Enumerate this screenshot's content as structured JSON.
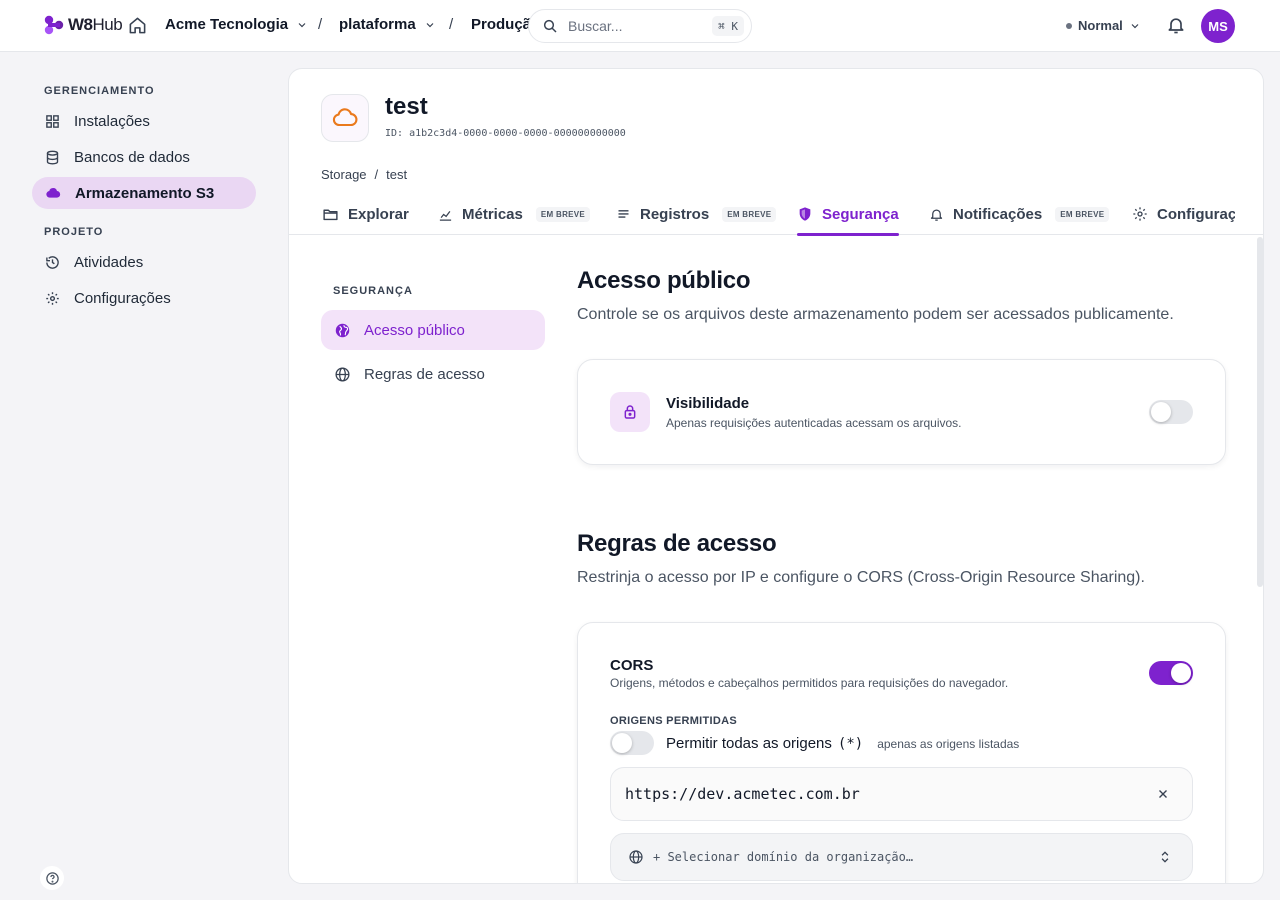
{
  "app": {
    "logo_w8": "W8",
    "logo_hub": "Hub"
  },
  "topbar": {
    "org": "Acme Tecnologia",
    "project": "plataforma",
    "env_crumb": "Produção",
    "separator": "/",
    "search_placeholder": "Buscar...",
    "search_shortcut": "⌘ K",
    "environment": "Normal",
    "avatar_initials": "MS"
  },
  "sidebar": {
    "section_management": "GERENCIAMENTO",
    "items_management": [
      {
        "label": "Instalações",
        "icon": "grid-icon"
      },
      {
        "label": "Bancos de dados",
        "icon": "database-icon"
      },
      {
        "label": "Armazenamento S3",
        "icon": "cloud-icon",
        "active": true
      }
    ],
    "section_project": "PROJETO",
    "items_project": [
      {
        "label": "Atividades",
        "icon": "history-icon"
      },
      {
        "label": "Configurações",
        "icon": "gear-icon"
      }
    ]
  },
  "resource": {
    "name": "test",
    "id": "ID: a1b2c3d4-0000-0000-0000-000000000000",
    "breadcrumb": [
      "Storage",
      "/",
      "test"
    ]
  },
  "tabs": [
    {
      "label": "Explorar",
      "icon": "folder-icon"
    },
    {
      "label": "Métricas",
      "icon": "chart-icon",
      "badge": "EM BREVE"
    },
    {
      "label": "Registros",
      "icon": "list-icon",
      "badge": "EM BREVE"
    },
    {
      "label": "Segurança",
      "icon": "shield-icon",
      "active": true
    },
    {
      "label": "Notificações",
      "icon": "bell-icon",
      "badge": "EM BREVE"
    },
    {
      "label": "Configuraç",
      "icon": "gear-icon"
    }
  ],
  "security_nav": {
    "title": "SEGURANÇA",
    "items": [
      {
        "label": "Acesso público",
        "icon": "globe-solid-icon",
        "active": true
      },
      {
        "label": "Regras de acesso",
        "icon": "globe-icon"
      }
    ]
  },
  "public_access": {
    "title": "Acesso público",
    "description": "Controle se os arquivos deste armazenamento podem ser acessados publicamente.",
    "visibility_title": "Visibilidade",
    "visibility_desc": "Apenas requisições autenticadas acessam os arquivos.",
    "visibility_enabled": false
  },
  "access_rules": {
    "title": "Regras de acesso",
    "description": "Restrinja o acesso por IP e configure o CORS (Cross-Origin Resource Sharing).",
    "cors_title": "CORS",
    "cors_desc": "Origens, métodos e cabeçalhos permitidos para requisições do navegador.",
    "cors_enabled": true,
    "origins_label": "ORIGENS PERMITIDAS",
    "allow_all_label": "Permitir todas as origens",
    "allow_all_symbol": "(*)",
    "allow_all_hint": "apenas as origens listadas",
    "allow_all_enabled": false,
    "origins": [
      "https://dev.acmetec.com.br"
    ],
    "select_placeholder": "+ Selecionar domínio da organização…"
  },
  "colors": {
    "accent": "#7e22ce",
    "accent_soft": "#ead7f3",
    "orange": "#ea7a1c"
  }
}
